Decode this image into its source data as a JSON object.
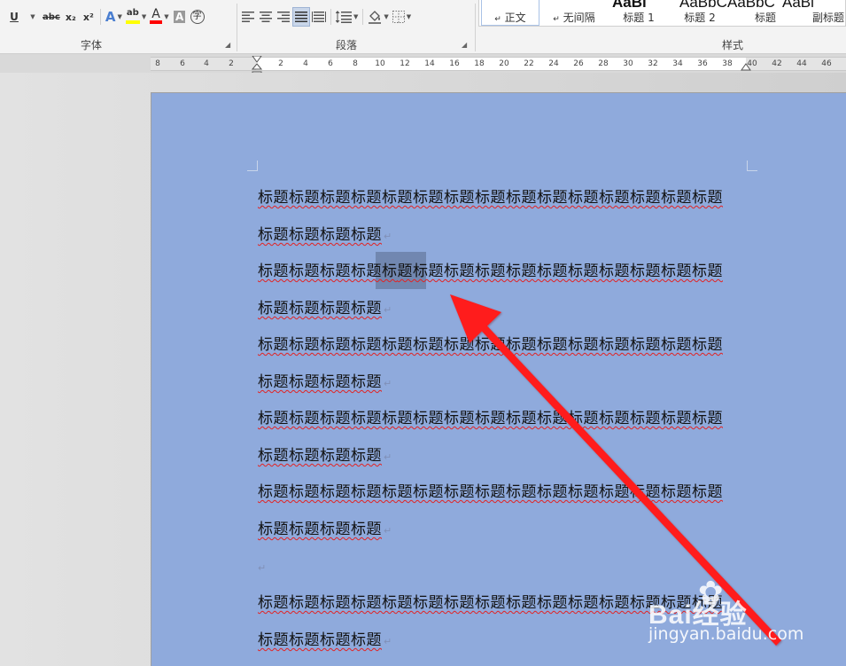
{
  "ribbon": {
    "font_group": {
      "label": "字体",
      "buttons": {
        "underline": "U",
        "strikethrough": "abc",
        "subscript": "x₂",
        "superscript": "x²",
        "text_effect": "A",
        "highlight": "ab",
        "font_color": "A",
        "char_shading": "A",
        "enclose_char": "字"
      },
      "colors": {
        "highlight": "#ffff00",
        "font_color": "#ff0000"
      }
    },
    "paragraph_group": {
      "label": "段落"
    },
    "styles_group": {
      "label": "样式",
      "tiles": [
        {
          "sample": "",
          "name": "正文",
          "mark": "↵"
        },
        {
          "sample": "AaBl",
          "name": "无间隔",
          "mark": "↵"
        },
        {
          "sample": "AaBbC",
          "name": "标题 1",
          "mark": ""
        },
        {
          "sample": "AaBbC",
          "name": "标题 2",
          "mark": ""
        },
        {
          "sample": "AaBl",
          "name": "标题",
          "mark": ""
        },
        {
          "sample": "",
          "name": "副标题",
          "mark": ""
        }
      ]
    }
  },
  "ruler": {
    "ticks_left": [
      "8",
      "6",
      "4",
      "2"
    ],
    "ticks_right": [
      "2",
      "4",
      "6",
      "8",
      "10",
      "12",
      "14",
      "16",
      "18",
      "20",
      "22",
      "24",
      "26",
      "28",
      "30",
      "32",
      "34",
      "36",
      "38",
      "40",
      "42",
      "44",
      "46"
    ]
  },
  "document": {
    "paragraph_mark": "↵",
    "lines": [
      {
        "text": "标题标题标题标题标题标题标题标题标题标题标题标题标题标题标题",
        "mark": false
      },
      {
        "text": "标题标题标题标题",
        "mark": true
      },
      {
        "text_before": "标题标题标题",
        "text_selected": "标题标",
        "text_after": "题标题标题标题标题标题标题标题标题标题标题",
        "mark": false
      },
      {
        "text": "标题标题标题标题",
        "mark": true
      },
      {
        "text": "标题标题标题标题标题标题标题标题标题标题标题标题标题标题标题",
        "mark": false
      },
      {
        "text": "标题标题标题标题",
        "mark": true
      },
      {
        "text": "标题标题标题标题标题标题标题标题标题标题标题标题标题标题标题",
        "mark": false
      },
      {
        "text": "标题标题标题标题",
        "mark": true
      },
      {
        "text": "标题标题标题标题标题标题标题标题标题标题标题标题标题标题标题",
        "mark": false
      },
      {
        "text": "标题标题标题标题",
        "mark": true
      },
      {
        "text": "",
        "mark": true
      },
      {
        "text": "标题标题标题标题标题标题标题标题标题标题标题标题标题标题标题",
        "mark": false
      },
      {
        "text": "标题标题标题标题",
        "mark": true
      }
    ]
  },
  "annotation": {
    "arrow_color": "#ff1a1a"
  },
  "watermark": {
    "brand": "Bai经验",
    "url": "jingyan.baidu.com"
  },
  "colors": {
    "page_bg": "#8faadc",
    "selection": "#6b7fa3",
    "spell_underline": "#e32222"
  }
}
